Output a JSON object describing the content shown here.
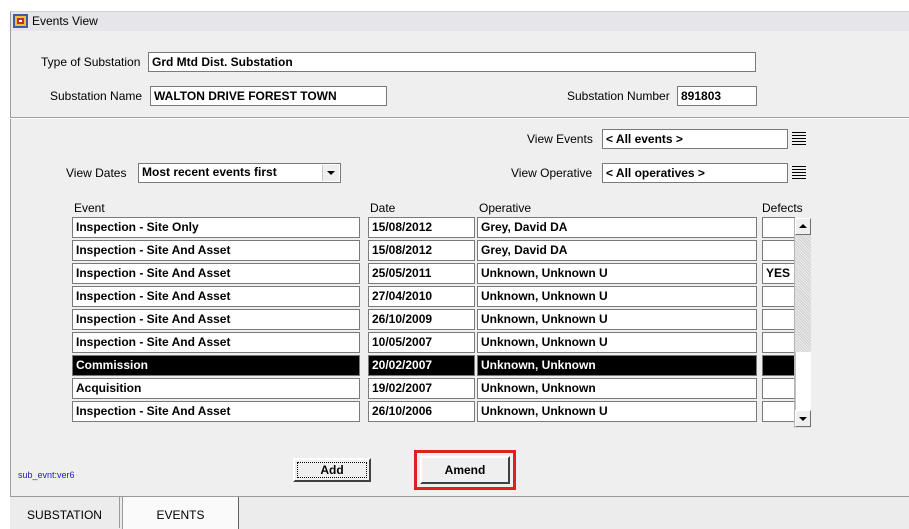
{
  "window": {
    "title": "Events View"
  },
  "header": {
    "type_label": "Type of Substation",
    "type_value": "Grd Mtd Dist. Substation",
    "name_label": "Substation Name",
    "name_value": "WALTON DRIVE FOREST TOWN",
    "number_label": "Substation Number",
    "number_value": "891803"
  },
  "filters": {
    "view_events_label": "View Events",
    "view_events_value": "< All events >",
    "view_dates_label": "View Dates",
    "view_dates_value": "Most recent events first",
    "view_operative_label": "View Operative",
    "view_operative_value": "< All operatives >"
  },
  "table": {
    "columns": [
      "Event",
      "Date",
      "Operative",
      "Defects"
    ],
    "rows": [
      {
        "event": "Inspection - Site Only",
        "date": "15/08/2012",
        "operative": "Grey, David DA",
        "defects": ""
      },
      {
        "event": "Inspection - Site And Asset",
        "date": "15/08/2012",
        "operative": "Grey, David DA",
        "defects": ""
      },
      {
        "event": "Inspection - Site And Asset",
        "date": "25/05/2011",
        "operative": "Unknown, Unknown U",
        "defects": "YES"
      },
      {
        "event": "Inspection - Site And Asset",
        "date": "27/04/2010",
        "operative": "Unknown, Unknown U",
        "defects": ""
      },
      {
        "event": "Inspection - Site And Asset",
        "date": "26/10/2009",
        "operative": "Unknown, Unknown U",
        "defects": ""
      },
      {
        "event": "Inspection - Site And Asset",
        "date": "10/05/2007",
        "operative": "Unknown, Unknown U",
        "defects": ""
      },
      {
        "event": "Commission",
        "date": "20/02/2007",
        "operative": "Unknown, Unknown",
        "defects": "",
        "selected": true
      },
      {
        "event": "Acquisition",
        "date": "19/02/2007",
        "operative": "Unknown, Unknown",
        "defects": ""
      },
      {
        "event": "Inspection - Site And Asset",
        "date": "26/10/2006",
        "operative": "Unknown, Unknown U",
        "defects": ""
      }
    ]
  },
  "buttons": {
    "add": "Add",
    "amend": "Amend"
  },
  "version_label": "sub_evnt:ver6",
  "tabs": [
    "SUBSTATION",
    "EVENTS"
  ],
  "colors": {
    "highlight": "#e02020",
    "selected_row": "#000000",
    "panel": "#efefef"
  }
}
